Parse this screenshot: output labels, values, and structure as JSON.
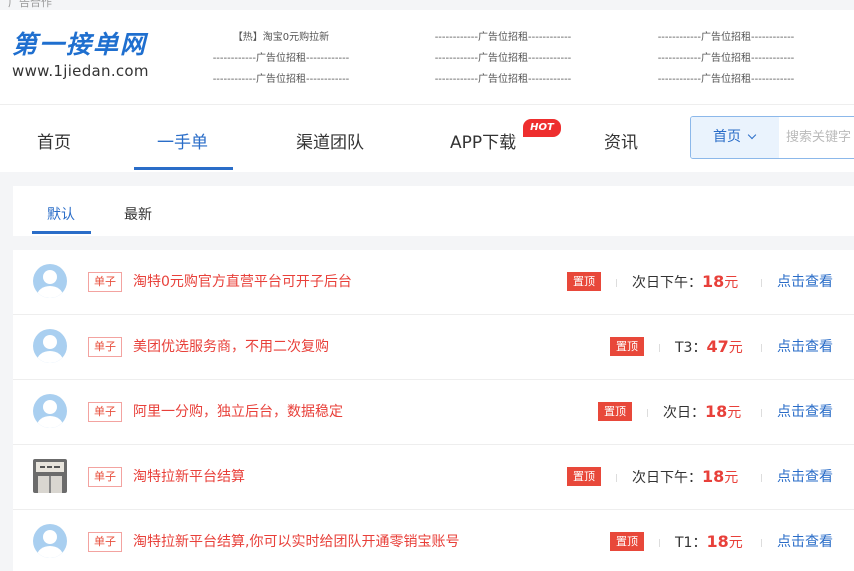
{
  "topstrip": {
    "text": "广告合作"
  },
  "logo": {
    "title": "第一接单网",
    "url": "www.1jiedan.com"
  },
  "ads": [
    [
      "【热】淘宝0元购拉新",
      "------------广告位招租------------",
      "------------广告位招租------------"
    ],
    [
      "------------广告位招租------------",
      "------------广告位招租------------",
      "------------广告位招租------------"
    ],
    [
      "------------广告位招租------------",
      "------------广告位招租------------",
      "------------广告位招租------------"
    ]
  ],
  "nav": {
    "items": [
      "首页",
      "一手单",
      "渠道团队",
      "APP下载",
      "资讯"
    ],
    "hot": "HOT"
  },
  "search": {
    "select": "首页",
    "placeholder": "搜索关键字"
  },
  "tabs": [
    "默认",
    "最新"
  ],
  "rows": [
    {
      "tag": "单子",
      "title": "淘特0元购官方直营平台可开子后台",
      "badge": "置顶",
      "time": "次日下午",
      "price": "18",
      "unit": "元",
      "action": "点击查看"
    },
    {
      "tag": "单子",
      "title": "美团优选服务商，不用二次复购",
      "badge": "置顶",
      "time": "T3",
      "price": "47",
      "unit": "元",
      "action": "点击查看"
    },
    {
      "tag": "单子",
      "title": "阿里一分购，独立后台，数据稳定",
      "badge": "置顶",
      "time": "次日",
      "price": "18",
      "unit": "元",
      "action": "点击查看"
    },
    {
      "tag": "单子",
      "title": "淘特拉新平台结算",
      "badge": "置顶",
      "time": "次日下午",
      "price": "18",
      "unit": "元",
      "action": "点击查看"
    },
    {
      "tag": "单子",
      "title": "淘特拉新平台结算,你可以实时给团队开通零销宝账号",
      "badge": "置顶",
      "time": "T1",
      "price": "18",
      "unit": "元",
      "action": "点击查看"
    }
  ],
  "colors": {
    "primary": "#2a6dc8",
    "accent": "#e8403a",
    "hot": "#ee2e2e"
  }
}
